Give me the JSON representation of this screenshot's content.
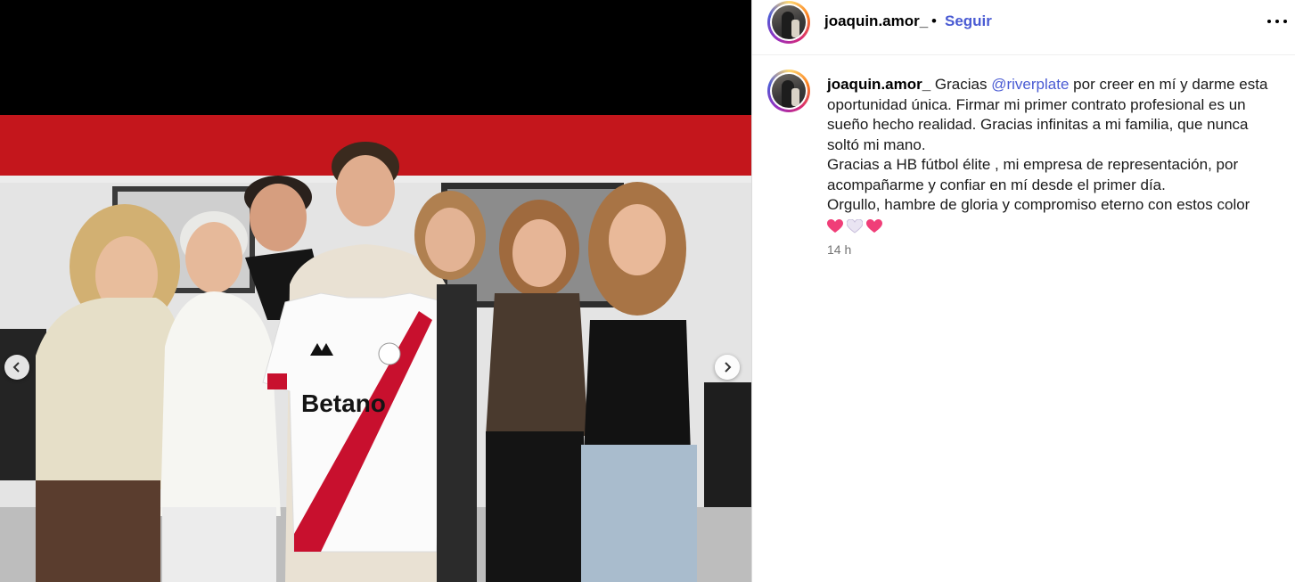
{
  "post": {
    "username": "joaquin.amor_",
    "separator": "•",
    "follow_label": "Seguir",
    "more_icon": "more-horizontal-icon"
  },
  "caption": {
    "username": "joaquin.amor_",
    "text_before_mention": "Gracias",
    "mention": "@riverplate",
    "text_after_mention": "por creer en mí y darme esta oportunidad única. Firmar mi primer contrato profesional es un sueño hecho realidad. Gracias infinitas a mi familia, que nunca soltó mi mano.",
    "paragraph_2": "Gracias a HB fútbol élite , mi empresa de representación, por acompañarme y confiar en mí desde el primer día.",
    "paragraph_3": "Orgullo, hambre de gloria y compromiso eterno con estos color",
    "emojis": [
      "heart-pink",
      "heart-white",
      "heart-pink"
    ],
    "timestamp": "14 h"
  },
  "media": {
    "jersey_sponsor": "Betano",
    "prev_icon": "chevron-left-icon",
    "next_icon": "chevron-right-icon"
  },
  "colors": {
    "link": "#4a5bd3",
    "river_red": "#c8102e",
    "muted": "#737373"
  }
}
